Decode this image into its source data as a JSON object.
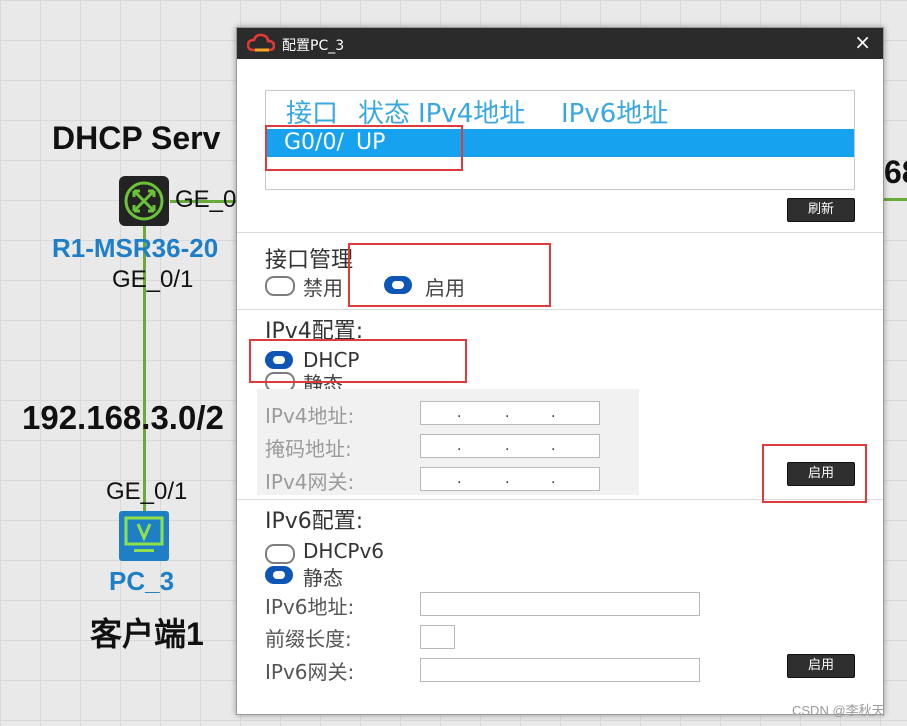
{
  "topology": {
    "server_label": "DHCP Serv",
    "router_name": "R1-MSR36-20",
    "router_port_right": "GE_0",
    "router_port_bottom": "GE_0/1",
    "network_label": "192.168.3.0/2",
    "pc_port": "GE_0/1",
    "pc_name": "PC_3",
    "client_label": "客户端1",
    "right_edge_label": "68"
  },
  "dialog": {
    "title": "配置PC_3",
    "close": "×",
    "table": {
      "headers": [
        "接口",
        "状态",
        "IPv4地址",
        "IPv6地址"
      ],
      "rows": [
        {
          "interface": "G0/0/",
          "status": "UP"
        }
      ]
    },
    "refresh_label": "刷新",
    "interface_mgmt": {
      "title": "接口管理",
      "disable": "禁用",
      "enable": "启用"
    },
    "ipv4": {
      "title": "IPv4配置:",
      "dhcp": "DHCP",
      "static": "静态",
      "addr_label": "IPv4地址:",
      "mask_label": "掩码地址:",
      "gw_label": "IPv4网关:",
      "apply_label": "启用"
    },
    "ipv6": {
      "title": "IPv6配置:",
      "dhcp": "DHCPv6",
      "static": "静态",
      "addr_label": "IPv6地址:",
      "prefix_label": "前缀长度:",
      "gw_label": "IPv6网关:",
      "apply_label": "启用"
    }
  },
  "watermark": "CSDN @李秋天",
  "colors": {
    "accent": "#16a2ee",
    "header_text": "#39a7e0",
    "radio_on": "#0d56b5",
    "highlight_box": "#e03a3a"
  }
}
